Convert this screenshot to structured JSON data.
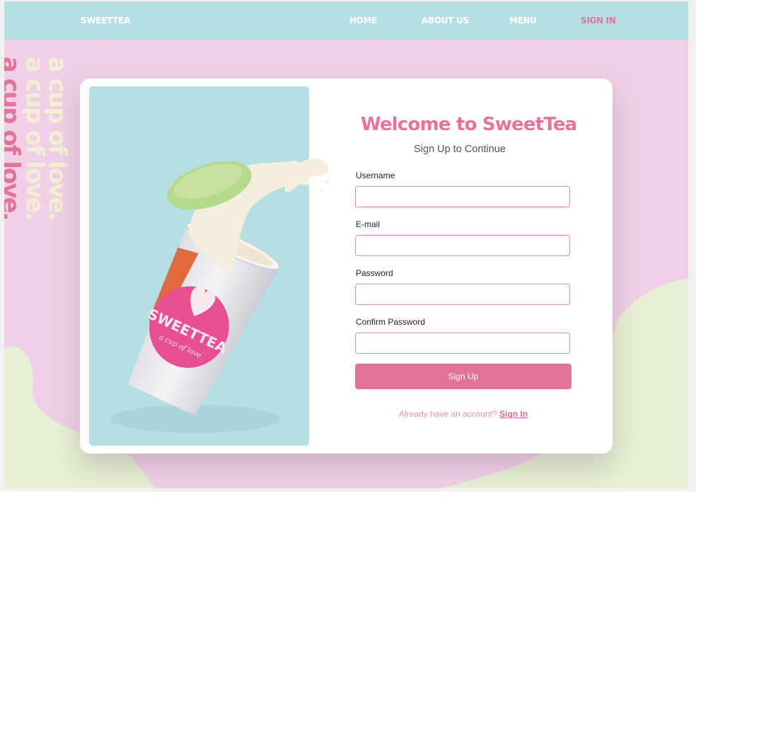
{
  "nav": {
    "brand": "SWEETTEA",
    "items": [
      {
        "label": "HOME"
      },
      {
        "label": "ABOUT US"
      },
      {
        "label": "MENU"
      },
      {
        "label": "SIGN IN",
        "active": true
      }
    ]
  },
  "decor": {
    "slogan": "a cup of love.",
    "cup_brand": "SWEETTEA",
    "cup_tagline": "a cup of love"
  },
  "form": {
    "title": "Welcome to SweetTea",
    "subtitle": "Sign Up to Continue",
    "fields": [
      {
        "label": "Username",
        "value": ""
      },
      {
        "label": "E-mail",
        "value": ""
      },
      {
        "label": "Password",
        "value": ""
      },
      {
        "label": "Confirm Password",
        "value": ""
      }
    ],
    "submit_label": "Sign Up",
    "signin_prompt": "Already have an account?",
    "signin_link": "Sign In"
  },
  "colors": {
    "navbar": "#b5e0e3",
    "background_pink": "#efd0e6",
    "background_green": "#e6f0d3",
    "accent_pink": "#e27298",
    "title_pink": "#ec709b"
  }
}
